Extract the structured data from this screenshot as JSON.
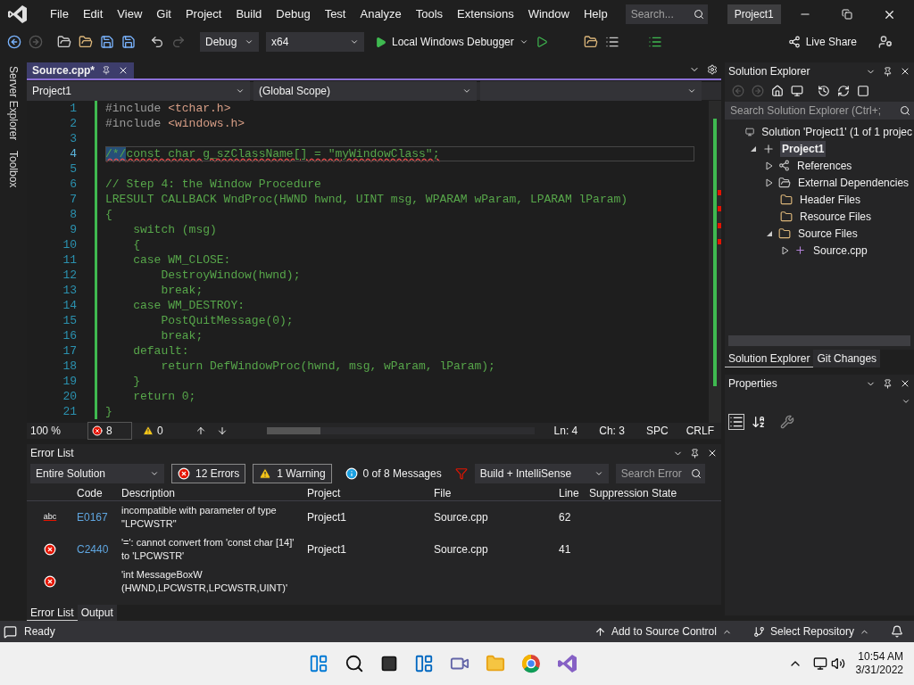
{
  "menu": [
    "File",
    "Edit",
    "View",
    "Git",
    "Project",
    "Build",
    "Debug",
    "Test",
    "Analyze",
    "Tools",
    "Extensions",
    "Window",
    "Help"
  ],
  "search": {
    "placeholder": "Search..."
  },
  "solution_name": "Project1",
  "toolbar": {
    "configuration": "Debug",
    "platform": "x64",
    "debugger": "Local Windows Debugger",
    "live_share": "Live Share"
  },
  "side_tabs": [
    "Server Explorer",
    "Toolbox"
  ],
  "editor": {
    "tab": {
      "label": "Source.cpp*",
      "selected": true
    },
    "nav": {
      "project": "Project1",
      "scope": "(Global Scope)"
    },
    "lines": [
      {
        "number": "1",
        "current": false,
        "segments": [
          {
            "kind": "plain",
            "text": "#include ",
            "squiggle": false
          },
          {
            "kind": "header",
            "text": "<tchar.h>",
            "squiggle": false
          }
        ]
      },
      {
        "number": "2",
        "current": false,
        "segments": [
          {
            "kind": "plain",
            "text": "#include ",
            "squiggle": false
          },
          {
            "kind": "header",
            "text": "<windows.h>",
            "squiggle": false
          }
        ]
      },
      {
        "number": "3",
        "current": false
      },
      {
        "number": "4",
        "current": true,
        "segments": [
          {
            "kind": "selected",
            "text": "/*/",
            "squiggle": true
          },
          {
            "kind": "comment",
            "text": "const char g_szClassName[] = \"myWindowClass\";",
            "squiggle": true
          }
        ]
      },
      {
        "number": "5",
        "current": false
      },
      {
        "number": "6",
        "current": false,
        "segments": [
          {
            "kind": "comment",
            "text": "// Step 4: the Window Procedure",
            "squiggle": false
          }
        ]
      },
      {
        "number": "7",
        "current": false,
        "segments": [
          {
            "kind": "comment",
            "text": "LRESULT CALLBACK WndProc(HWND hwnd, UINT msg, WPARAM wParam, LPARAM lParam)",
            "squiggle": false
          }
        ]
      },
      {
        "number": "8",
        "current": false,
        "segments": [
          {
            "kind": "comment",
            "text": "{",
            "squiggle": false
          }
        ]
      },
      {
        "number": "9",
        "current": false,
        "segments": [
          {
            "kind": "comment",
            "text": "    switch (msg)",
            "squiggle": false
          }
        ]
      },
      {
        "number": "10",
        "current": false,
        "segments": [
          {
            "kind": "comment",
            "text": "    {",
            "squiggle": false
          }
        ]
      },
      {
        "number": "11",
        "current": false,
        "segments": [
          {
            "kind": "comment",
            "text": "    case WM_CLOSE:",
            "squiggle": false
          }
        ]
      },
      {
        "number": "12",
        "current": false,
        "segments": [
          {
            "kind": "comment",
            "text": "        DestroyWindow(hwnd);",
            "squiggle": false
          }
        ]
      },
      {
        "number": "13",
        "current": false,
        "segments": [
          {
            "kind": "comment",
            "text": "        break;",
            "squiggle": false
          }
        ]
      },
      {
        "number": "14",
        "current": false,
        "segments": [
          {
            "kind": "comment",
            "text": "    case WM_DESTROY:",
            "squiggle": false
          }
        ]
      },
      {
        "number": "15",
        "current": false,
        "segments": [
          {
            "kind": "comment",
            "text": "        PostQuitMessage(0);",
            "squiggle": false
          }
        ]
      },
      {
        "number": "16",
        "current": false,
        "segments": [
          {
            "kind": "comment",
            "text": "        break;",
            "squiggle": false
          }
        ]
      },
      {
        "number": "17",
        "current": false,
        "segments": [
          {
            "kind": "comment",
            "text": "    default:",
            "squiggle": false
          }
        ]
      },
      {
        "number": "18",
        "current": false,
        "segments": [
          {
            "kind": "comment",
            "text": "        return DefWindowProc(hwnd, msg, wParam, lParam);",
            "squiggle": false
          }
        ]
      },
      {
        "number": "19",
        "current": false,
        "segments": [
          {
            "kind": "comment",
            "text": "    }",
            "squiggle": false
          }
        ]
      },
      {
        "number": "20",
        "current": false,
        "segments": [
          {
            "kind": "comment",
            "text": "    return 0;",
            "squiggle": false
          }
        ]
      },
      {
        "number": "21",
        "current": false,
        "segments": [
          {
            "kind": "comment",
            "text": "}",
            "squiggle": false
          }
        ]
      }
    ],
    "status": {
      "zoom": "100 %",
      "errors": "8",
      "warnings": "0",
      "line": "Ln: 4",
      "column": "Ch: 3",
      "indent": "SPC",
      "line_ending": "CRLF"
    }
  },
  "error_list": {
    "title": "Error List",
    "scope": "Entire Solution",
    "filters": [
      {
        "kind": "error",
        "label": "12 Errors",
        "on": true
      },
      {
        "kind": "warning",
        "label": "1 Warning",
        "on": true
      },
      {
        "kind": "info",
        "label": "0 of 8 Messages",
        "on": false
      }
    ],
    "source": "Build + IntelliSense",
    "search": {
      "placeholder": "Search Error"
    },
    "columns": [
      "Code",
      "Description",
      "Project",
      "File",
      "Line",
      "Suppression State"
    ],
    "rows": [
      {
        "kind": "intellisense",
        "badge": "abc",
        "code": "E0167",
        "description": "incompatible with parameter of type \"LPCWSTR\"",
        "project": "Project1",
        "file": "Source.cpp",
        "line": "62"
      },
      {
        "kind": "error",
        "code": "C2440",
        "description": "'=': cannot convert from 'const char [14]' to 'LPCWSTR'",
        "project": "Project1",
        "file": "Source.cpp",
        "line": "41"
      },
      {
        "kind": "error",
        "description": "'int MessageBoxW (HWND,LPCWSTR,LPCWSTR,UINT)'"
      }
    ],
    "tabs": [
      {
        "label": "Error List",
        "selected": true
      },
      {
        "label": "Output",
        "selected": false
      }
    ]
  },
  "solution_explorer": {
    "title": "Solution Explorer",
    "search": {
      "placeholder": "Search Solution Explorer (Ctrl+;"
    },
    "tree": [
      {
        "label": "Solution 'Project1' (1 of 1 projec",
        "kind": "solution",
        "selected": false,
        "children": [
          {
            "label": "Project1",
            "kind": "project",
            "expanded": true,
            "selected": true,
            "children": [
              {
                "label": "References",
                "kind": "references",
                "expanded": false,
                "selected": false
              },
              {
                "label": "External Dependencies",
                "kind": "dependencies",
                "expanded": false,
                "selected": false
              },
              {
                "label": "Header Files",
                "kind": "filter",
                "selected": false
              },
              {
                "label": "Resource Files",
                "kind": "filter",
                "selected": false
              },
              {
                "label": "Source Files",
                "kind": "filter",
                "expanded": true,
                "selected": false,
                "children": [
                  {
                    "label": "Source.cpp",
                    "kind": "cpp",
                    "expanded": false,
                    "selected": false
                  }
                ]
              }
            ]
          }
        ]
      }
    ],
    "tabs": [
      {
        "label": "Solution Explorer",
        "selected": true
      },
      {
        "label": "Git Changes",
        "selected": false
      }
    ]
  },
  "properties": {
    "title": "Properties"
  },
  "status_bar": {
    "message": "Ready",
    "source_control": "Add to Source Control",
    "repository": "Select Repository"
  },
  "taskbar": {
    "time": "10:54 AM",
    "date": "3/31/2022"
  }
}
